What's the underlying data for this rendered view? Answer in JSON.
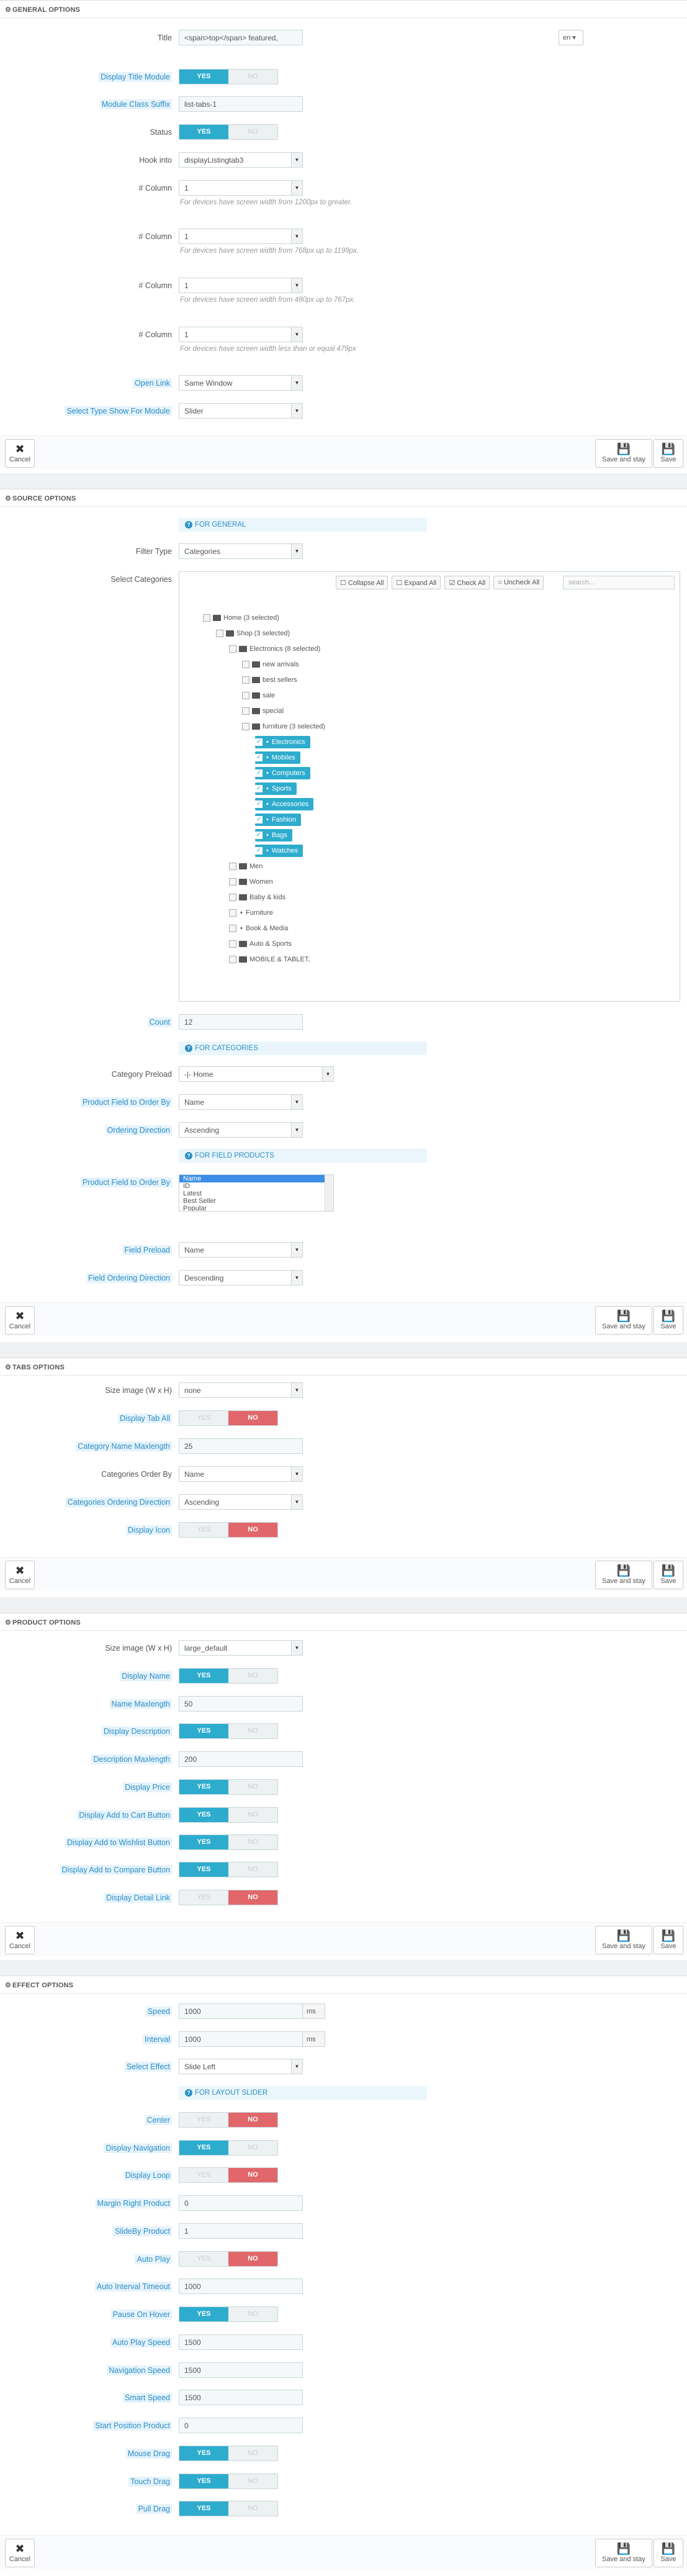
{
  "general": {
    "title": "General options",
    "title_label": "Title",
    "title_value": "<span>top</span> featured,",
    "lang_flag": "en ▾",
    "display_title_label": "Display Title Module",
    "class_suffix_label": "Module Class Suffix",
    "class_suffix_value": "list-tabs-1",
    "status_label": "Status",
    "hook_label": "Hook into",
    "hook_value": "displayListingtab3",
    "col_label": "# Column",
    "col1_value": "1",
    "col1_help": "For devices have screen width from 1200px to greater.",
    "col2_value": "1",
    "col2_help": "For devices have screen width from 768px up to 1199px.",
    "col3_value": "1",
    "col3_help": "For devices have screen width from 480px up to 767px.",
    "col4_value": "1",
    "col4_help": "For devices have screen width less than or equal 479px",
    "open_link_label": "Open Link",
    "open_link_value": "Same Window",
    "select_type_label": "Select Type Show For Module",
    "select_type_value": "Slider"
  },
  "yes": "YES",
  "no": "NO",
  "footer": {
    "cancel": "Cancel",
    "save_stay": "Save and stay",
    "save": "Save"
  },
  "source": {
    "title": "Source options",
    "for_general": "FOR GENERAL",
    "filter_type_label": "Filter Type",
    "filter_type_value": "Categories",
    "select_categories_label": "Select Categories",
    "tree_buttons": [
      "Collapse All",
      "Expand All",
      "Check All",
      "Uncheck All"
    ],
    "search_placeholder": "search...",
    "tree": [
      {
        "label": "Home (3 selected)",
        "depth": 0,
        "folder": true,
        "checked": false,
        "hl": false
      },
      {
        "label": "Shop (3 selected)",
        "depth": 1,
        "folder": true,
        "checked": false,
        "hl": false
      },
      {
        "label": "Electronics (8 selected)",
        "depth": 2,
        "folder": true,
        "checked": false,
        "hl": false
      },
      {
        "label": "new arrivals",
        "depth": 3,
        "folder": true,
        "checked": false,
        "hl": false
      },
      {
        "label": "best sellers",
        "depth": 3,
        "folder": true,
        "checked": false,
        "hl": false
      },
      {
        "label": "sale",
        "depth": 3,
        "folder": true,
        "checked": false,
        "hl": false
      },
      {
        "label": "special",
        "depth": 3,
        "folder": true,
        "checked": false,
        "hl": false
      },
      {
        "label": "furniture (3 selected)",
        "depth": 3,
        "folder": true,
        "checked": false,
        "hl": false
      },
      {
        "label": "Electronics",
        "depth": 4,
        "folder": false,
        "checked": true,
        "hl": true
      },
      {
        "label": "Mobiles",
        "depth": 4,
        "folder": false,
        "checked": true,
        "hl": true
      },
      {
        "label": "Computers",
        "depth": 4,
        "folder": false,
        "checked": true,
        "hl": true
      },
      {
        "label": "Sports",
        "depth": 4,
        "folder": false,
        "checked": true,
        "hl": true
      },
      {
        "label": "Accessories",
        "depth": 4,
        "folder": false,
        "checked": true,
        "hl": true
      },
      {
        "label": "Fashion",
        "depth": 4,
        "folder": false,
        "checked": true,
        "hl": true
      },
      {
        "label": "Bags",
        "depth": 4,
        "folder": false,
        "checked": true,
        "hl": true
      },
      {
        "label": "Watches",
        "depth": 4,
        "folder": false,
        "checked": true,
        "hl": true
      },
      {
        "label": "Men",
        "depth": 2,
        "folder": true,
        "checked": false,
        "hl": false
      },
      {
        "label": "Women",
        "depth": 2,
        "folder": true,
        "checked": false,
        "hl": false
      },
      {
        "label": "Baby & kids",
        "depth": 2,
        "folder": true,
        "checked": false,
        "hl": false
      },
      {
        "label": "Furniture",
        "depth": 2,
        "folder": false,
        "checked": false,
        "hl": false
      },
      {
        "label": "Book & Media",
        "depth": 2,
        "folder": false,
        "checked": false,
        "hl": false
      },
      {
        "label": "Auto & Sports",
        "depth": 2,
        "folder": true,
        "checked": false,
        "hl": false
      },
      {
        "label": "MOBILE & TABLET,",
        "depth": 2,
        "folder": true,
        "checked": false,
        "hl": false
      }
    ],
    "count_label": "Count",
    "count_value": "12",
    "for_categories": "FOR CATEGORIES",
    "cat_preload_label": "Category Preload",
    "cat_preload_value": "-|- Home",
    "pf_order_label": "Product Field to Order By",
    "pf_order_value": "Name",
    "order_dir_label": "Ordering Direction",
    "order_dir_value": "Ascending",
    "for_field": "FOR FIELD PRODUCTS",
    "pf_order2_label": "Product Field to Order By",
    "pf_order2_options": [
      "Name",
      "ID",
      "Latest",
      "Best Seller",
      "Popular"
    ],
    "field_preload_label": "Field Preload",
    "field_preload_value": "Name",
    "field_order_dir_label": "Field Ordering Direction",
    "field_order_dir_value": "Descending"
  },
  "tabs": {
    "title": "Tabs options",
    "size_label": "Size image (W x H)",
    "size_value": "none",
    "display_tab_all_label": "Display Tab All",
    "cat_maxlen_label": "Category Name Maxlength",
    "cat_maxlen_value": "25",
    "cat_order_label": "Categories Order By",
    "cat_order_value": "Name",
    "cat_order_dir_label": "Categories Ordering Direction",
    "cat_order_dir_value": "Ascending",
    "display_icon_label": "Display Icon"
  },
  "product": {
    "title": "Product options",
    "size_label": "Size image (W x H)",
    "size_value": "large_default",
    "display_name_label": "Display Name",
    "name_maxlen_label": "Name Maxlength",
    "name_maxlen_value": "50",
    "display_desc_label": "Display Description",
    "desc_maxlen_label": "Description Maxlength",
    "desc_maxlen_value": "200",
    "display_price_label": "Display Price",
    "cart_label": "Display Add to Cart Button",
    "wishlist_label": "Display Add to Wishlist Button",
    "compare_label": "Display Add to Compare Button",
    "detail_label": "Display Detail Link"
  },
  "effect": {
    "title": "Effect options",
    "speed_label": "Speed",
    "speed_value": "1000",
    "ms": "ms",
    "interval_label": "Interval",
    "interval_value": "1000",
    "effect_label": "Select Effect",
    "effect_value": "Slide Left",
    "for_slider": "FOR LAYOUT SLIDER",
    "center_label": "Center",
    "nav_label": "Display Navigation",
    "loop_label": "Display Loop",
    "margin_label": "Margin Right Product",
    "margin_value": "0",
    "slideby_label": "SlideBy Product",
    "slideby_value": "1",
    "autoplay_label": "Auto Play",
    "ait_label": "Auto Interval Timeout",
    "ait_value": "1000",
    "pause_label": "Pause On Hover",
    "aps_label": "Auto Play Speed",
    "aps_value": "1500",
    "navspeed_label": "Navigation Speed",
    "navspeed_value": "1500",
    "smart_label": "Smart Speed",
    "smart_value": "1500",
    "start_label": "Start Position Product",
    "start_value": "0",
    "mouse_label": "Mouse Drag",
    "touch_label": "Touch Drag",
    "pull_label": "Pull Drag"
  }
}
